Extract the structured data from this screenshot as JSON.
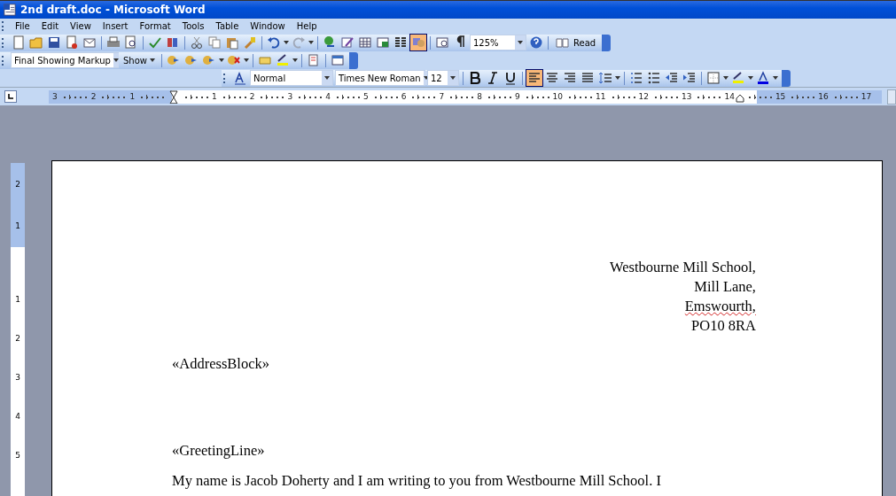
{
  "window": {
    "title": "2nd draft.doc - Microsoft Word"
  },
  "menu": [
    "File",
    "Edit",
    "View",
    "Insert",
    "Format",
    "Tools",
    "Table",
    "Window",
    "Help"
  ],
  "standard_toolbar": {
    "drawing_pressed": true,
    "zoom": "125%",
    "read_button": "Read"
  },
  "reviewing_toolbar": {
    "display": "Final Showing Markup",
    "show_button": "Show"
  },
  "formatting_toolbar": {
    "style": "Normal",
    "font": "Times New Roman",
    "size": "12",
    "alignment": [
      {
        "selected": true
      },
      {
        "selected": false
      },
      {
        "selected": false
      },
      {
        "selected": false
      }
    ]
  },
  "ruler": {
    "left_numbers": [
      "3",
      "2",
      "1"
    ],
    "right_numbers": [
      "1",
      "2",
      "3",
      "4",
      "5",
      "6",
      "7",
      "8",
      "9",
      "10",
      "11",
      "12",
      "13",
      "14",
      "15",
      "16",
      "17"
    ]
  },
  "vertical_ruler": {
    "top_numbers": [
      "2",
      "1"
    ],
    "numbers": [
      "1",
      "2",
      "3",
      "4",
      "5"
    ]
  },
  "document": {
    "sender_address": [
      "Westbourne Mill School,",
      "Mill Lane,",
      "Emswourth,",
      "PO10 8RA"
    ],
    "address_field": "«AddressBlock»",
    "greeting_field": "«GreetingLine»",
    "body": "My name is Jacob Doherty and I am writing to you from Westbourne Mill School. I"
  }
}
